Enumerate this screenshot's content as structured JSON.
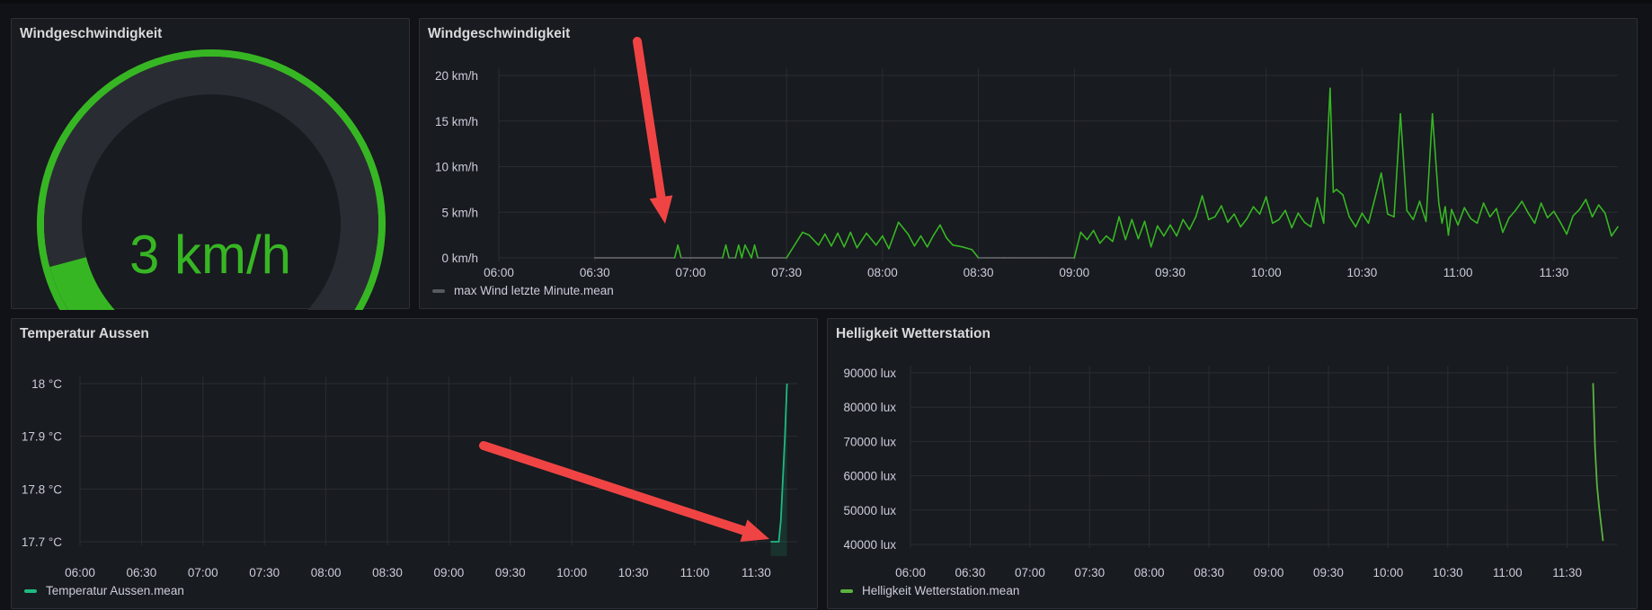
{
  "panels": {
    "gauge": {
      "title": "Windgeschwindigkeit",
      "value_text": "3 km/h",
      "value": 3,
      "min": 0,
      "max": 20,
      "color": "#37b624"
    },
    "wind": {
      "title": "Windgeschwindigkeit",
      "legend": "max Wind letzte Minute.mean",
      "legend_color": "#585a61",
      "line_color": "#37b624",
      "zero_color": "#6b6d73"
    },
    "temp": {
      "title": "Temperatur Aussen",
      "legend": "Temperatur Aussen.mean",
      "color": "#1fb97f"
    },
    "lux": {
      "title": "Helligkeit Wetterstation",
      "legend": "Helligkeit Wetterstation.mean",
      "color": "#5bb340"
    }
  },
  "chart_data": [
    {
      "type": "line",
      "title": "Windgeschwindigkeit",
      "x_ticks": [
        "06:00",
        "06:30",
        "07:00",
        "07:30",
        "08:00",
        "08:30",
        "09:00",
        "09:30",
        "10:00",
        "10:30",
        "11:00",
        "11:30"
      ],
      "y_ticks": [
        "0 km/h",
        "5 km/h",
        "10 km/h",
        "15 km/h",
        "20 km/h"
      ],
      "ylim": [
        0,
        20
      ],
      "xlim": [
        "06:00",
        "11:50"
      ],
      "grid": true,
      "legend_position": "bottom-left",
      "series": [
        {
          "name": "max Wind letzte Minute.mean",
          "x": [
            "06:30",
            "06:55",
            "06:56",
            "06:57",
            "07:10",
            "07:11",
            "07:12",
            "07:14",
            "07:15",
            "07:16",
            "07:17",
            "07:19",
            "07:20",
            "07:21",
            "07:30",
            "07:35",
            "07:37",
            "07:40",
            "07:42",
            "07:44",
            "07:46",
            "07:48",
            "07:50",
            "07:52",
            "07:55",
            "07:58",
            "08:00",
            "08:02",
            "08:05",
            "08:08",
            "08:10",
            "08:12",
            "08:14",
            "08:16",
            "08:18",
            "08:20",
            "08:22",
            "08:25",
            "08:28",
            "08:30",
            "08:33",
            "08:36",
            "08:38",
            "08:40",
            "08:50",
            "09:00",
            "09:02",
            "09:04",
            "09:06",
            "09:08",
            "09:10",
            "09:12",
            "09:14",
            "09:16",
            "09:18",
            "09:20",
            "09:22",
            "09:24",
            "09:26",
            "09:28",
            "09:30",
            "09:32",
            "09:34",
            "09:36",
            "09:38",
            "09:40",
            "09:42",
            "09:44",
            "09:46",
            "09:48",
            "09:50",
            "09:52",
            "09:54",
            "09:56",
            "09:58",
            "10:00",
            "10:02",
            "10:04",
            "10:06",
            "10:08",
            "10:10",
            "10:12",
            "10:14",
            "10:16",
            "10:18",
            "10:20",
            "10:21",
            "10:22",
            "10:24",
            "10:26",
            "10:28",
            "10:30",
            "10:32",
            "10:34",
            "10:36",
            "10:38",
            "10:40",
            "10:42",
            "10:44",
            "10:45",
            "10:46",
            "10:48",
            "10:50",
            "10:52",
            "10:54",
            "10:55",
            "10:56",
            "10:57",
            "10:58",
            "11:00",
            "11:02",
            "11:04",
            "11:06",
            "11:08",
            "11:10",
            "11:12",
            "11:14",
            "11:16",
            "11:18",
            "11:20",
            "11:22",
            "11:24",
            "11:26",
            "11:28",
            "11:30",
            "11:32",
            "11:34",
            "11:36",
            "11:38",
            "11:40",
            "11:42",
            "11:44",
            "11:46",
            "11:48",
            "11:50"
          ],
          "y": [
            0,
            0,
            1.4,
            0,
            0,
            1.4,
            0,
            0,
            1.4,
            0,
            1.4,
            0,
            1.4,
            0,
            0,
            2.8,
            2.5,
            1.4,
            2.6,
            1.3,
            2.7,
            1.2,
            2.8,
            1.1,
            2.7,
            1.4,
            2.4,
            1.0,
            3.9,
            2.6,
            1.3,
            2.4,
            1.2,
            2.5,
            3.6,
            2.2,
            1.4,
            1.2,
            0.9,
            0,
            0,
            0,
            0,
            0,
            0,
            0,
            2.8,
            2.0,
            3.0,
            1.6,
            2.4,
            1.8,
            4.5,
            2.0,
            4.2,
            2.1,
            4.0,
            1.2,
            3.5,
            2.4,
            3.6,
            2.4,
            4.2,
            3.1,
            4.5,
            6.8,
            4.2,
            4.5,
            5.7,
            3.9,
            4.8,
            3.4,
            4.3,
            5.6,
            4.8,
            6.7,
            3.8,
            4.2,
            5.2,
            3.3,
            4.9,
            3.9,
            3.4,
            6.6,
            3.8,
            18.6,
            7.2,
            7.5,
            6.9,
            4.5,
            3.4,
            4.9,
            3.8,
            6.5,
            9.3,
            4.8,
            4.5,
            15.8,
            5.2,
            4.7,
            4.2,
            6.2,
            4.0,
            15.8,
            6.0,
            3.8,
            5.6,
            2.5,
            5.3,
            3.6,
            5.5,
            4.3,
            3.8,
            6.0,
            4.5,
            5.4,
            2.8,
            4.4,
            5.2,
            6.2,
            4.9,
            3.8,
            6.0,
            4.4,
            5.1,
            3.9,
            2.6,
            4.6,
            5.3,
            6.4,
            4.5,
            5.8,
            4.9,
            2.4,
            3.4
          ]
        }
      ]
    },
    {
      "type": "line",
      "title": "Temperatur Aussen",
      "x_ticks": [
        "06:00",
        "06:30",
        "07:00",
        "07:30",
        "08:00",
        "08:30",
        "09:00",
        "09:30",
        "10:00",
        "10:30",
        "11:00",
        "11:30"
      ],
      "y_ticks": [
        "17.7 °C",
        "17.8 °C",
        "17.9 °C",
        "18 °C"
      ],
      "ylim": [
        17.7,
        18.0
      ],
      "grid": true,
      "legend_position": "bottom-left",
      "series": [
        {
          "name": "Temperatur Aussen.mean",
          "x": [
            "11:37",
            "11:40",
            "11:41",
            "11:42",
            "11:43",
            "11:44",
            "11:45"
          ],
          "y": [
            17.7,
            17.7,
            17.7,
            17.74,
            17.82,
            17.9,
            18.0
          ]
        }
      ]
    },
    {
      "type": "line",
      "title": "Helligkeit Wetterstation",
      "x_ticks": [
        "06:00",
        "06:30",
        "07:00",
        "07:30",
        "08:00",
        "08:30",
        "09:00",
        "09:30",
        "10:00",
        "10:30",
        "11:00",
        "11:30"
      ],
      "y_ticks": [
        "40000 lux",
        "50000 lux",
        "60000 lux",
        "70000 lux",
        "80000 lux",
        "90000 lux"
      ],
      "ylim": [
        40000,
        90000
      ],
      "grid": true,
      "legend_position": "bottom-left",
      "series": [
        {
          "name": "Helligkeit Wetterstation.mean",
          "x": [
            "11:43",
            "11:44",
            "11:45",
            "11:46",
            "11:47",
            "11:48"
          ],
          "y": [
            87000,
            68000,
            57000,
            51000,
            46000,
            41000
          ]
        }
      ]
    }
  ],
  "annotations": {
    "arrow_color": "#f04444"
  }
}
